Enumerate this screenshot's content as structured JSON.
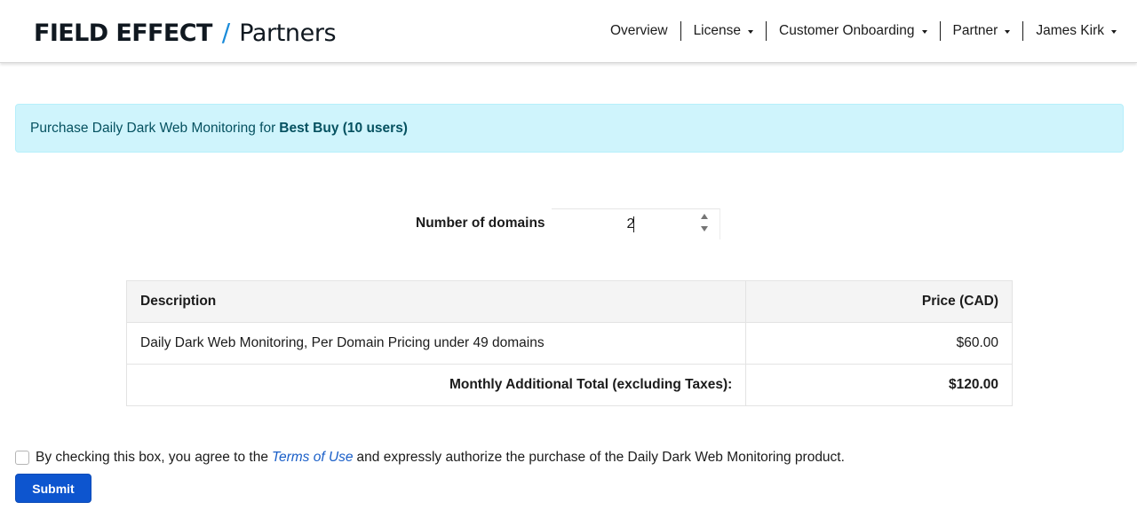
{
  "header": {
    "logo": {
      "brand": "FIELD EFFECT",
      "slash": "/",
      "sub": "Partners"
    },
    "nav": [
      {
        "label": "Overview",
        "dropdown": false
      },
      {
        "label": "License",
        "dropdown": true
      },
      {
        "label": "Customer Onboarding",
        "dropdown": true
      },
      {
        "label": "Partner",
        "dropdown": true
      },
      {
        "label": "James Kirk",
        "dropdown": true
      }
    ]
  },
  "alert": {
    "prefix": "Purchase Daily Dark Web Monitoring for",
    "customer": "Best Buy (10 users)"
  },
  "domains": {
    "label": "Number of domains",
    "value": "2"
  },
  "table": {
    "headers": {
      "description": "Description",
      "price": "Price (CAD)"
    },
    "rows": [
      {
        "description": "Daily Dark Web Monitoring, Per Domain Pricing under 49 domains",
        "price": "$60.00"
      }
    ],
    "total": {
      "label": "Monthly Additional Total (excluding Taxes):",
      "value": "$120.00"
    }
  },
  "agreement": {
    "checked": false,
    "before": "By checking this box, you agree to the",
    "link": "Terms of Use",
    "after": "and expressly authorize the purchase of the Daily Dark Web Monitoring product."
  },
  "submit_label": "Submit",
  "colors": {
    "alert_bg": "#cff4fc",
    "alert_text": "#055160",
    "primary_button": "#0d55cf",
    "link": "#1a5fc8",
    "logo_slash": "#1a8bd9"
  }
}
